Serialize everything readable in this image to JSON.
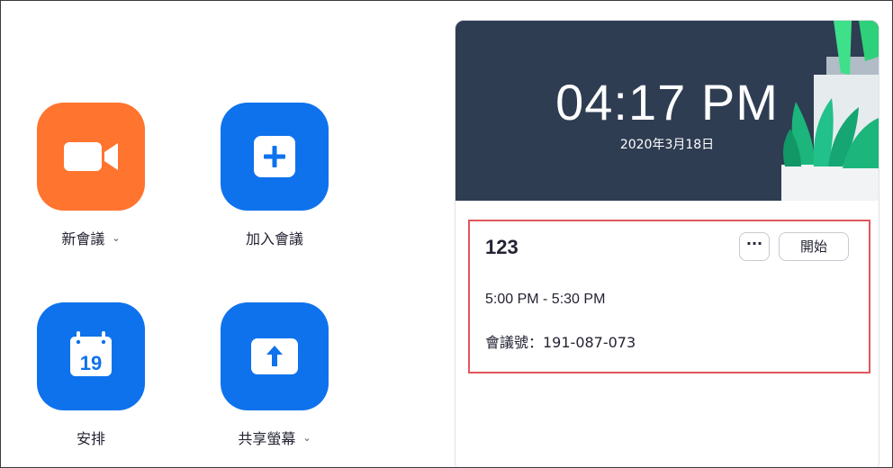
{
  "actions": {
    "new_meeting": {
      "label": "新會議",
      "icon": "video-camera-icon",
      "color": "#ff742e",
      "has_dropdown": true
    },
    "join": {
      "label": "加入會議",
      "icon": "plus-icon",
      "color": "#0e72ed"
    },
    "schedule": {
      "label": "安排",
      "icon": "calendar-icon",
      "calendar_day": "19",
      "color": "#0e72ed"
    },
    "share_screen": {
      "label": "共享螢幕",
      "icon": "upload-arrow-icon",
      "color": "#0e72ed",
      "has_dropdown": true
    }
  },
  "dropdown_glyph": "⌄",
  "header": {
    "time": "04:17 PM",
    "date": "2020年3月18日"
  },
  "meeting": {
    "title": "123",
    "more_label": "···",
    "start_label": "開始",
    "time_range": "5:00 PM - 5:30 PM",
    "meeting_id": "會議號：191-087-073"
  },
  "colors": {
    "highlight_border": "#e0575c",
    "hero_bg": "#2e3d52",
    "plant_green": "#1cb57c"
  }
}
